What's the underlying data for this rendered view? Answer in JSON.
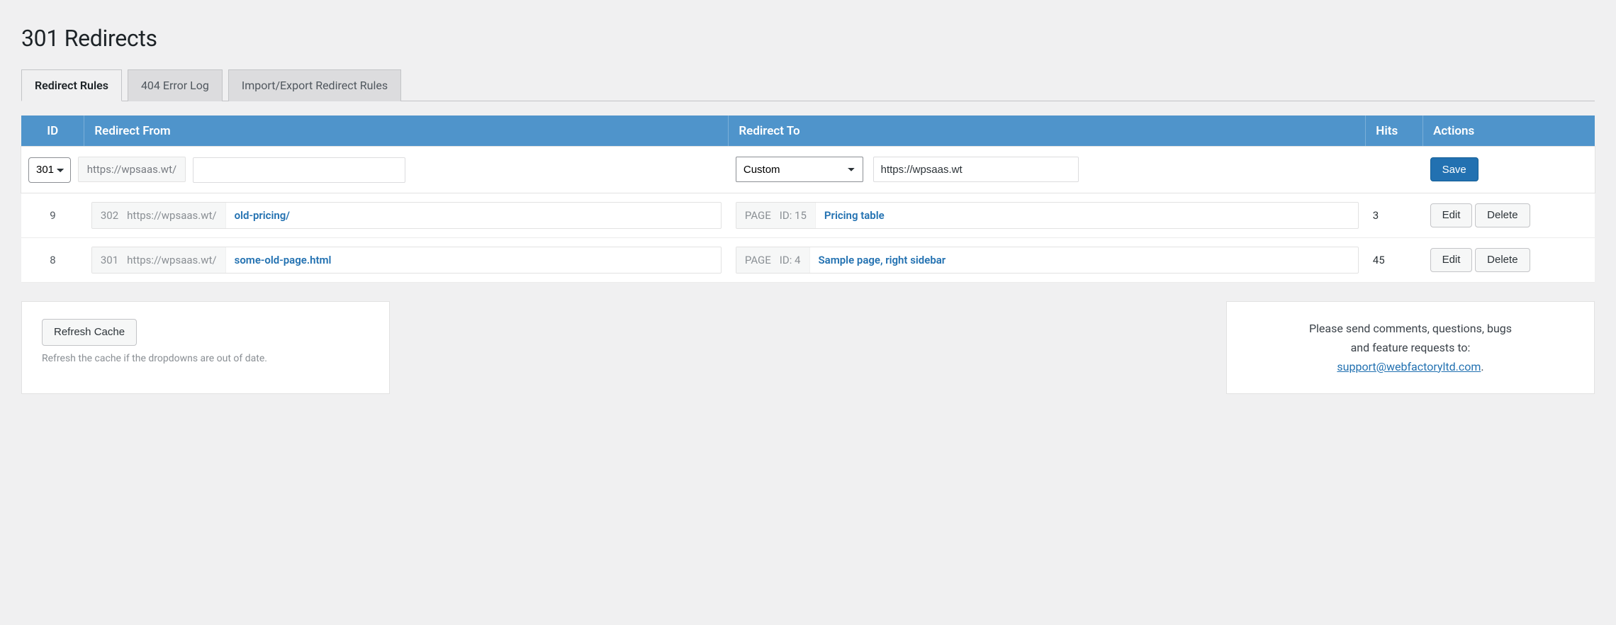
{
  "page": {
    "title": "301 Redirects"
  },
  "tabs": {
    "rules": "Redirect Rules",
    "log404": "404 Error Log",
    "import": "Import/Export Redirect Rules"
  },
  "columns": {
    "id": "ID",
    "from": "Redirect From",
    "to": "Redirect To",
    "hits": "Hits",
    "actions": "Actions"
  },
  "new_rule": {
    "code": "301",
    "domain": "https://wpsaas.wt/",
    "slug": "",
    "to_type": "Custom",
    "to_url": "https://wpsaas.wt",
    "save_label": "Save"
  },
  "rows": [
    {
      "id": "9",
      "code": "302",
      "domain": "https://wpsaas.wt/",
      "slug": "old-pricing/",
      "to_kind": "PAGE",
      "to_id_label": "ID: 15",
      "to_title": "Pricing table",
      "hits": "3"
    },
    {
      "id": "8",
      "code": "301",
      "domain": "https://wpsaas.wt/",
      "slug": "some-old-page.html",
      "to_kind": "PAGE",
      "to_id_label": "ID: 4",
      "to_title": "Sample page, right sidebar",
      "hits": "45"
    }
  ],
  "buttons": {
    "edit": "Edit",
    "delete": "Delete",
    "refresh": "Refresh Cache"
  },
  "refresh_hint": "Refresh the cache if the dropdowns are out of date.",
  "support": {
    "line1": "Please send comments, questions, bugs",
    "line2": "and feature requests to:",
    "email": "support@webfactoryltd.com",
    "dot": "."
  }
}
